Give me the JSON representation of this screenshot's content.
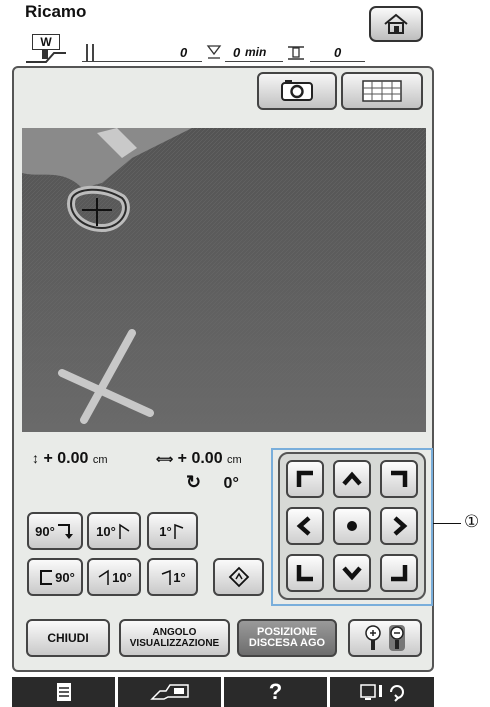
{
  "header": {
    "title": "Ricamo",
    "mode_badge": "W",
    "presser_count": "0",
    "time_value": "0",
    "time_unit": "min",
    "stitch_count": "0"
  },
  "camera": {
    "camera_icon": "camera-icon",
    "grid_icon": "grid-icon"
  },
  "readout": {
    "vertical_value": "+ 0.00",
    "vertical_unit": "cm",
    "horizontal_value": "+ 0.00",
    "horizontal_unit": "cm",
    "angle_value": "0°"
  },
  "rotate": {
    "r90": "90°",
    "r10": "10°",
    "r1": "1°",
    "l90": "90°",
    "l10": "10°",
    "l1": "1°"
  },
  "callout_number": "①",
  "buttons": {
    "close": "CHIUDI",
    "view_angle_line1": "ANGOLO",
    "view_angle_line2": "VISUALIZZAZIONE",
    "needle_pos_line1": "POSIZIONE",
    "needle_pos_line2": "DISCESA AGO"
  },
  "bottom_tabs": [
    {
      "icon": "document-icon"
    },
    {
      "icon": "embroidery-frame-icon"
    },
    {
      "label": "?"
    },
    {
      "icon": "settings-cycle-icon"
    }
  ]
}
